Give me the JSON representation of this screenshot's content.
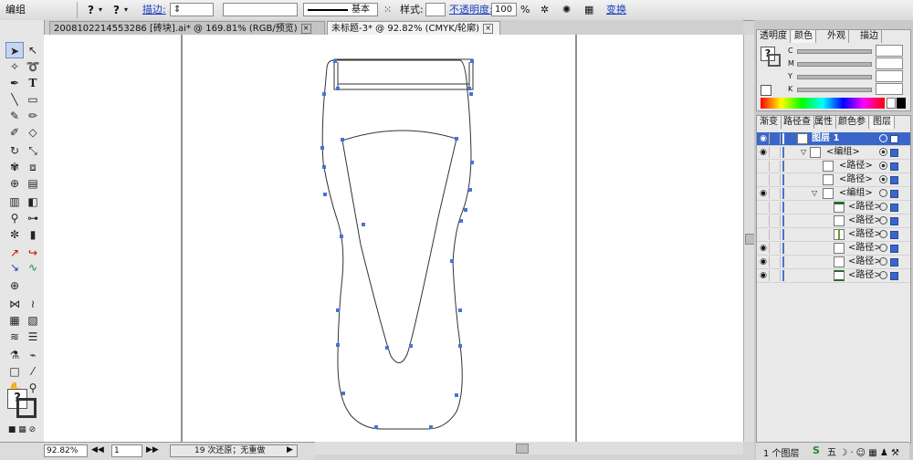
{
  "control_bar": {
    "mode_label": "编组",
    "question_mark": "?",
    "stroke_link": "描边:",
    "stroke_style": "基本",
    "style_label": "样式:",
    "opacity_link": "不透明度:",
    "opacity_value": "100",
    "opacity_unit": "%",
    "transform_link": "变换"
  },
  "tabs": [
    {
      "label": "20081022145532​86 [砖块].ai* @ 169.81% (RGB/预览)"
    },
    {
      "label": "未标题-3* @ 92.82% (CMYK/轮廓)"
    }
  ],
  "status_bar": {
    "zoom": "92.82%",
    "page": "1",
    "undo_status": "19 次还原；无重做"
  },
  "color_panel": {
    "tabs": [
      "透明度",
      "颜色",
      "外观",
      "描边"
    ],
    "channels": [
      "C",
      "M",
      "Y",
      "K"
    ]
  },
  "layers_panel": {
    "tabs": [
      "渐变",
      "路径查",
      "属性",
      "颜色参",
      "图层"
    ],
    "rows": [
      {
        "name": "图层 1"
      },
      {
        "name": "<编组>"
      },
      {
        "name": "<路径>"
      },
      {
        "name": "<路径>"
      },
      {
        "name": "<编组>"
      },
      {
        "name": "<路径>"
      },
      {
        "name": "<路径>"
      },
      {
        "name": "<路径>"
      },
      {
        "name": "<路径>"
      },
      {
        "name": "<路径>"
      },
      {
        "name": "<路径>"
      }
    ],
    "footer": "1 个图层"
  },
  "colors": {
    "selection": "#3a66c9",
    "anchor": "#4a73d1"
  }
}
